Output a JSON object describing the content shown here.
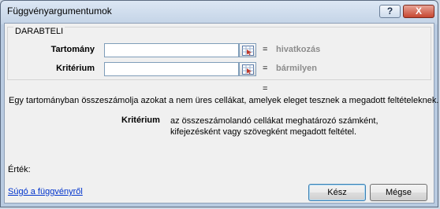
{
  "window": {
    "title": "Függvényargumentumok",
    "help_label": "?",
    "close_label": "X"
  },
  "function": {
    "name": "DARABTELI",
    "args": [
      {
        "label": "Tartomány",
        "value": "",
        "equals": "=",
        "result": "hivatkozás"
      },
      {
        "label": "Kritérium",
        "value": "",
        "equals": "=",
        "result": "bármilyen"
      }
    ],
    "total_equals": "="
  },
  "description": "Egy tartományban összeszámolja azokat a nem üres cellákat, amelyek eleget tesznek a megadott feltételeknek.",
  "arg_help": {
    "name": "Kritérium",
    "text": "az összeszámolandó cellákat meghatározó számként, kifejezésként vagy szövegként megadott feltétel."
  },
  "result_label": "Érték:",
  "help_link": "Súgó a függvényről",
  "buttons": {
    "ok": "Kész",
    "cancel": "Mégse"
  }
}
